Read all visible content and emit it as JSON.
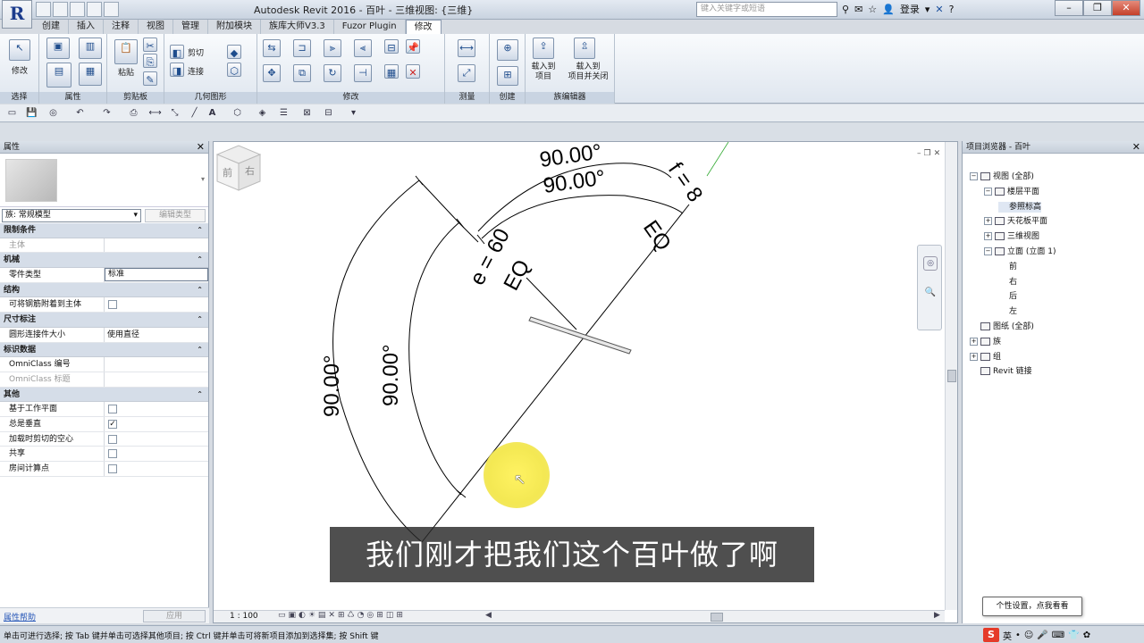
{
  "app": {
    "title": "Autodesk Revit 2016 -     百叶 - 三维视图: {三维}",
    "logo": "R"
  },
  "search": {
    "placeholder": "键入关键字或短语"
  },
  "account": {
    "login": "登录"
  },
  "tabs": [
    "创建",
    "插入",
    "注释",
    "视图",
    "管理",
    "附加模块",
    "族库大师V3.3",
    "Fuzor Plugin",
    "修改"
  ],
  "active_tab": "修改",
  "ribbon": {
    "modify_label": "修改",
    "paste_label": "粘贴",
    "cut_label": "剪切",
    "join_label": "连接",
    "load_into_project": "载入到\n项目",
    "load_into_project_close": "载入到\n项目并关闭",
    "panels": {
      "select": "选择",
      "properties": "属性",
      "clipboard": "剪贴板",
      "geometry": "几何图形",
      "modify": "修改",
      "measure": "测量",
      "create": "创建",
      "family_editor": "族编辑器"
    }
  },
  "properties": {
    "title": "属性",
    "family": "族: 常规模型",
    "edit_type": "编辑类型",
    "help": "属性帮助",
    "apply": "应用",
    "sections": [
      {
        "name": "限制条件",
        "rows": [
          {
            "k": "主体",
            "v": "",
            "dim": true
          }
        ]
      },
      {
        "name": "机械",
        "rows": [
          {
            "k": "零件类型",
            "v": "标准",
            "input": true
          }
        ]
      },
      {
        "name": "结构",
        "rows": [
          {
            "k": "可将钢筋附着到主体",
            "check": false
          }
        ]
      },
      {
        "name": "尺寸标注",
        "rows": [
          {
            "k": "圆形连接件大小",
            "v": "使用直径"
          }
        ]
      },
      {
        "name": "标识数据",
        "rows": [
          {
            "k": "OmniClass 编号",
            "v": ""
          },
          {
            "k": "OmniClass 标题",
            "v": "",
            "dim": true
          }
        ]
      },
      {
        "name": "其他",
        "rows": [
          {
            "k": "基于工作平面",
            "check": false
          },
          {
            "k": "总是垂直",
            "check": true
          },
          {
            "k": "加载时剪切的空心",
            "check": false
          },
          {
            "k": "共享",
            "check": false
          },
          {
            "k": "房间计算点",
            "check": false
          }
        ]
      }
    ]
  },
  "canvas": {
    "dims": {
      "angle_top1": "90.00°",
      "angle_top2": "90.00°",
      "angle_left1": "90.00°",
      "angle_left2": "90.00°",
      "e_label": "e = 60",
      "f_label": "f = 8",
      "eq1": "EQ",
      "eq2": "EQ"
    },
    "scale": "1 : 100",
    "cube_front": "前",
    "cube_right": "右"
  },
  "project_browser": {
    "title": "项目浏览器 - 百叶",
    "nodes": [
      {
        "label": "视图 (全部)",
        "toggle": "−",
        "depth": 0
      },
      {
        "label": "楼层平面",
        "toggle": "−",
        "depth": 1
      },
      {
        "label": "参照标高",
        "toggle": "",
        "depth": 2,
        "selected": true
      },
      {
        "label": "天花板平面",
        "toggle": "+",
        "depth": 1
      },
      {
        "label": "三维视图",
        "toggle": "+",
        "depth": 1
      },
      {
        "label": "立面 (立面 1)",
        "toggle": "−",
        "depth": 1
      },
      {
        "label": "前",
        "toggle": "",
        "depth": 2
      },
      {
        "label": "右",
        "toggle": "",
        "depth": 2
      },
      {
        "label": "后",
        "toggle": "",
        "depth": 2
      },
      {
        "label": "左",
        "toggle": "",
        "depth": 2
      },
      {
        "label": "图纸 (全部)",
        "toggle": "",
        "depth": 0
      },
      {
        "label": "族",
        "toggle": "+",
        "depth": 0
      },
      {
        "label": "组",
        "toggle": "+",
        "depth": 0
      },
      {
        "label": "Revit 链接",
        "toggle": "",
        "depth": 0
      }
    ]
  },
  "tooltip": "个性设置，点我看看",
  "status": "单击可进行选择; 按 Tab 键并单击可选择其他项目; 按 Ctrl 键并单击可将新项目添加到选择集; 按 Shift 键",
  "tray": {
    "ime": "S",
    "lang": "英"
  },
  "subtitle": "我们刚才把我们这个百叶做了啊"
}
